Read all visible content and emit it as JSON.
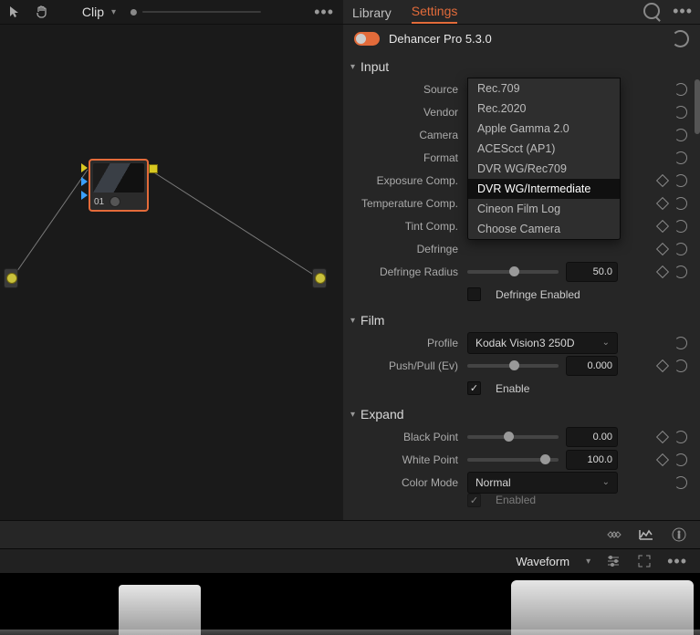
{
  "node_panel": {
    "clip_label": "Clip",
    "node_number": "01"
  },
  "tabs": {
    "library": "Library",
    "settings": "Settings"
  },
  "plugin": {
    "name": "Dehancer Pro 5.3.0"
  },
  "sections": {
    "input": {
      "title": "Input",
      "source_label": "Source",
      "source_value": "Choose Camera",
      "vendor_label": "Vendor",
      "camera_label": "Camera",
      "format_label": "Format",
      "exposure_label": "Exposure Comp.",
      "temperature_label": "Temperature Comp.",
      "tint_label": "Tint Comp.",
      "defringe_label": "Defringe",
      "defringe_radius_label": "Defringe Radius",
      "defringe_radius_value": "50.0",
      "defringe_enabled_label": "Defringe Enabled",
      "dropdown_options": [
        "Rec.709",
        "Rec.2020",
        "Apple Gamma 2.0",
        "ACEScct (AP1)",
        "DVR WG/Rec709",
        "DVR WG/Intermediate",
        "Cineon Film Log",
        "Choose Camera"
      ],
      "dropdown_highlight": "DVR WG/Intermediate"
    },
    "film": {
      "title": "Film",
      "profile_label": "Profile",
      "profile_value": "Kodak Vision3 250D",
      "pushpull_label": "Push/Pull (Ev)",
      "pushpull_value": "0.000",
      "enable_label": "Enable"
    },
    "expand": {
      "title": "Expand",
      "black_label": "Black Point",
      "black_value": "0.00",
      "white_label": "White Point",
      "white_value": "100.0",
      "color_mode_label": "Color Mode",
      "color_mode_value": "Normal",
      "enabled_label": "Enabled"
    }
  },
  "waveform": {
    "label": "Waveform"
  }
}
